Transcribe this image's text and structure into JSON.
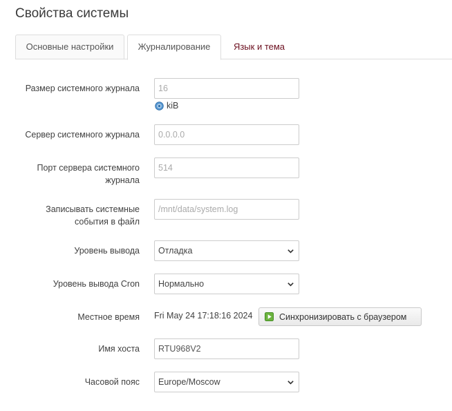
{
  "page": {
    "title": "Свойства системы"
  },
  "tabs": [
    {
      "label": "Основные настройки"
    },
    {
      "label": "Журналирование"
    },
    {
      "label": "Язык и тема"
    }
  ],
  "form": {
    "log_size": {
      "label": "Размер системного журнала",
      "placeholder": "16",
      "unit": "kiB",
      "hint_icon": "info-icon"
    },
    "log_server": {
      "label": "Сервер системного журнала",
      "placeholder": "0.0.0.0"
    },
    "log_port": {
      "label_line1": "Порт сервера системного",
      "label_line2": "журнала",
      "placeholder": "514"
    },
    "log_file": {
      "label_line1": "Записывать системные",
      "label_line2": "события в файл",
      "placeholder": "/mnt/data/system.log"
    },
    "log_level": {
      "label": "Уровень вывода",
      "value": "Отладка"
    },
    "cron_level": {
      "label": "Уровень вывода Cron",
      "value": "Нормально"
    },
    "local_time": {
      "label": "Местное время",
      "value": "Fri May 24 17:18:16 2024",
      "sync_label": "Синхронизировать с браузером",
      "sync_icon": "play-icon"
    },
    "hostname": {
      "label": "Имя хоста",
      "value": "RTU968V2"
    },
    "timezone": {
      "label": "Часовой пояс",
      "value": "Europe/Moscow"
    }
  },
  "colors": {
    "tab_link": "#6b0e1e",
    "info_icon": "#4a90c8",
    "sync_icon": "#5aa23a"
  }
}
